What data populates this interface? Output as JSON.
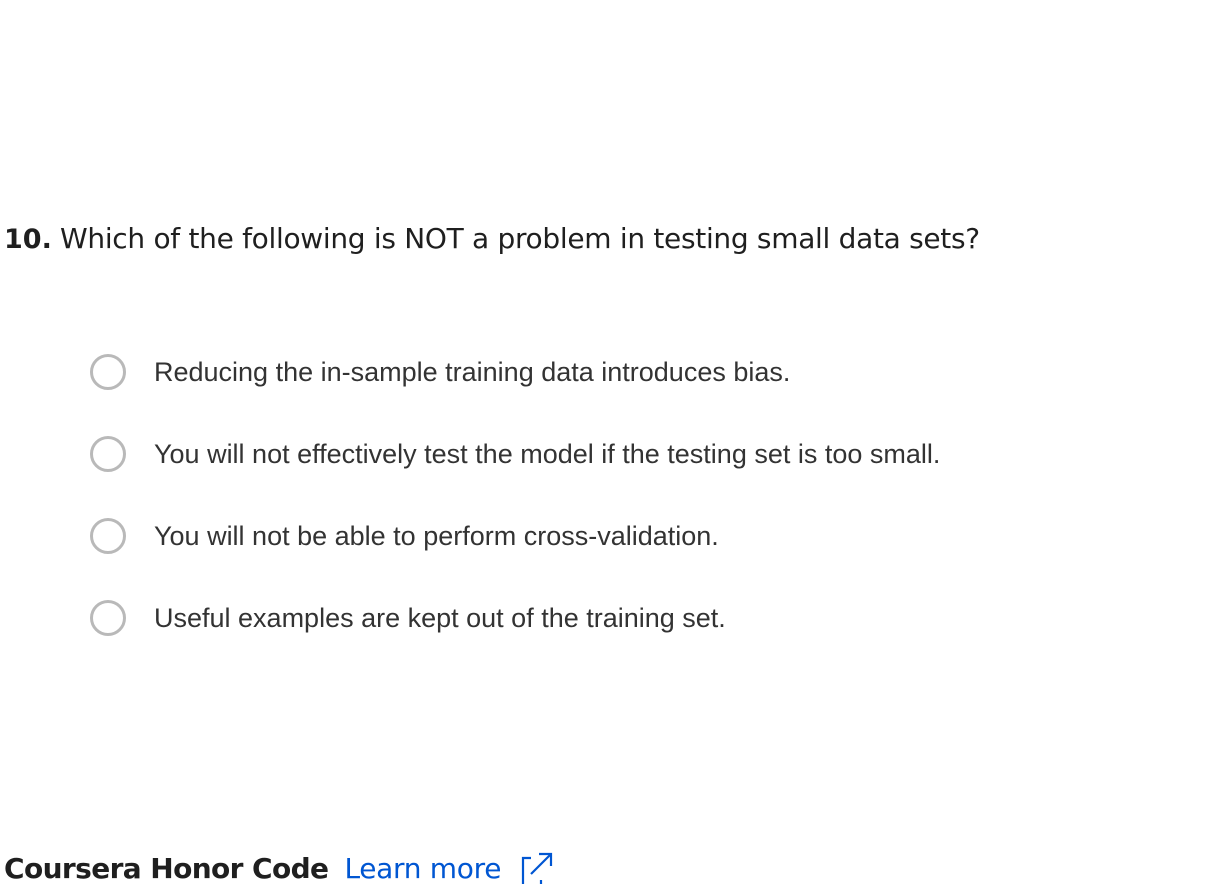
{
  "question": {
    "number": "10.",
    "text": "Which of the following is NOT a problem in testing small data sets?"
  },
  "options": [
    {
      "label": "Reducing the in-sample training data introduces bias.",
      "selected": false
    },
    {
      "label": "You will not effectively test the model if the testing set is too small.",
      "selected": false
    },
    {
      "label": "You will not be able to perform cross-validation.",
      "selected": false
    },
    {
      "label": "Useful examples are kept out of the training set.",
      "selected": false
    }
  ],
  "footer": {
    "honor_code_label": "Coursera Honor Code",
    "learn_more_label": "Learn more",
    "learn_more_icon": "external-link-icon"
  },
  "colors": {
    "link": "#0056d2",
    "radio_border": "#b9b9b9",
    "text": "#1f1f1f"
  }
}
